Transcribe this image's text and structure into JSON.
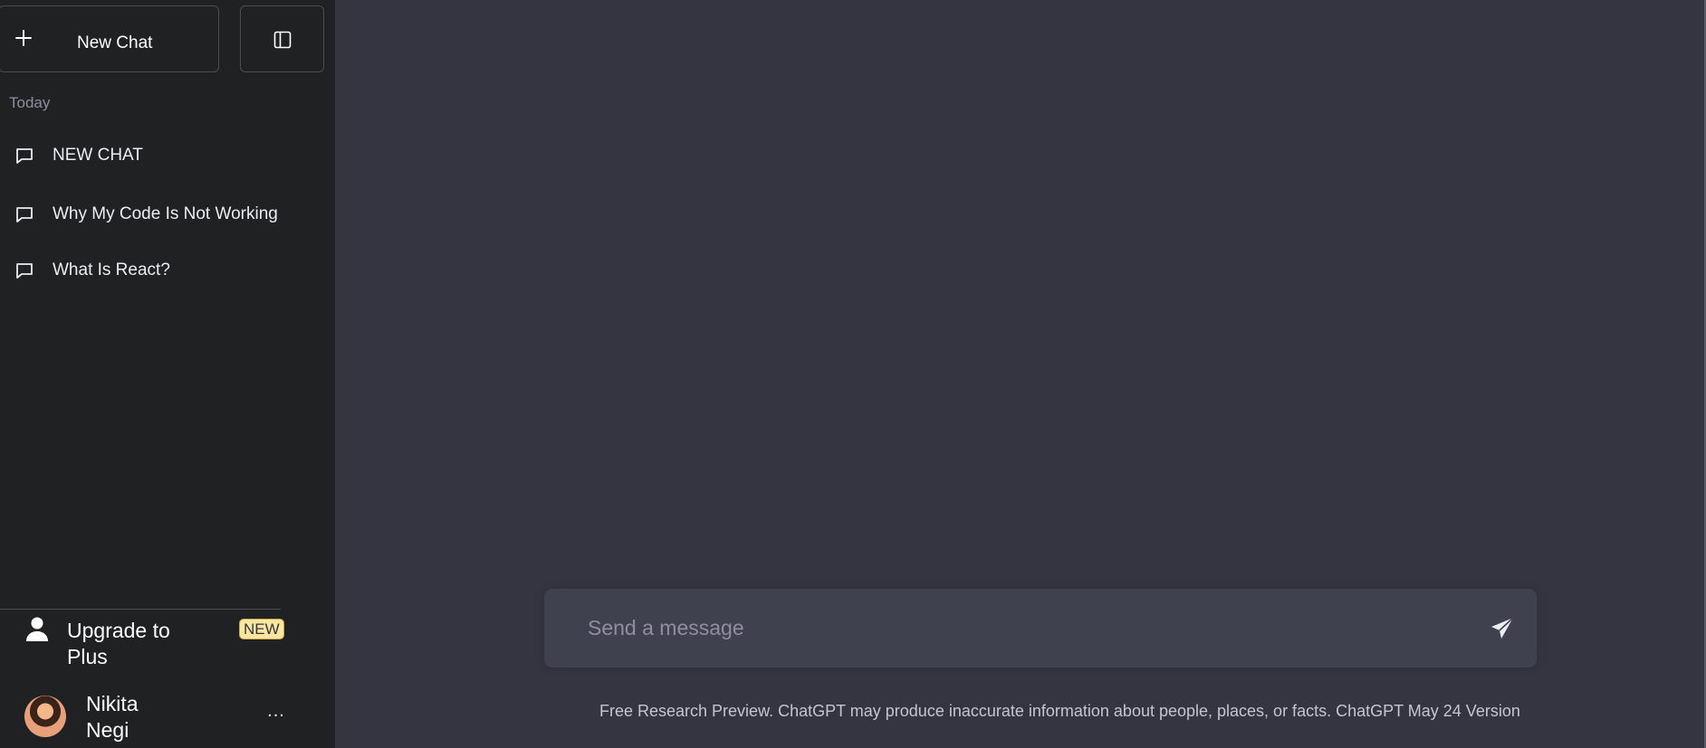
{
  "sidebar": {
    "new_chat_label": "New Chat",
    "section_label": "Today",
    "history": [
      {
        "title": "NEW CHAT"
      },
      {
        "title": "Why My Code Is Not Working"
      },
      {
        "title": "What Is React?"
      }
    ],
    "upgrade": {
      "label": "Upgrade to Plus",
      "badge": "NEW"
    },
    "user": {
      "name": "Nikita Negi",
      "more_label": "..."
    }
  },
  "main": {
    "composer": {
      "placeholder": "Send a message"
    },
    "footer": "Free Research Preview. ChatGPT may produce inaccurate information about people, places, or facts. ChatGPT May 24 Version"
  },
  "icons": {
    "new_chat": "plus-icon",
    "toggle": "sidebar-toggle-icon",
    "history": "chat-bubble-icon",
    "upgrade": "user-icon",
    "send": "paper-plane-icon",
    "more": "more-horizontal-icon"
  },
  "colors": {
    "sidebar_bg": "#202123",
    "main_bg": "#343541",
    "composer_bg": "#40414f",
    "badge_bg": "#fae69e"
  }
}
